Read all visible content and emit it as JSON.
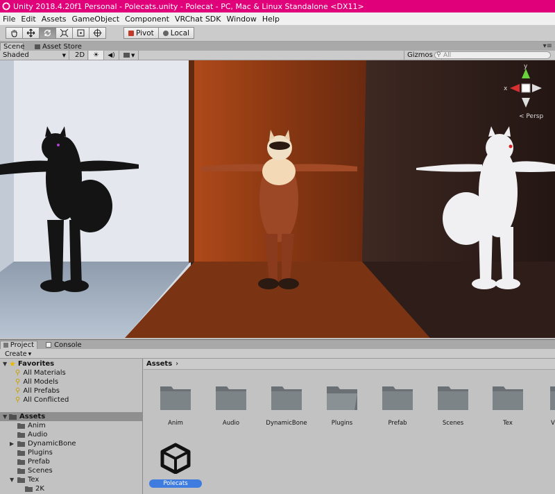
{
  "window": {
    "title": "Unity 2018.4.20f1 Personal - Polecats.unity - Polecat - PC, Mac & Linux Standalone <DX11>"
  },
  "menu": [
    "File",
    "Edit",
    "Assets",
    "GameObject",
    "Component",
    "VRChat SDK",
    "Window",
    "Help"
  ],
  "toolbar": {
    "pivot_label": "Pivot",
    "local_label": "Local"
  },
  "scene_tabs": {
    "scene": "Scene",
    "asset_store": "Asset Store"
  },
  "scene_toolbar": {
    "shading_mode": "Shaded",
    "mode_2d": "2D",
    "gizmos": "Gizmos",
    "search_placeholder": "All"
  },
  "gizmo": {
    "y_label": "y",
    "x_label": "x",
    "projection": "Persp"
  },
  "bottom_tabs": {
    "project": "Project",
    "console": "Console"
  },
  "project_toolbar": {
    "create": "Create"
  },
  "favorites": {
    "label": "Favorites",
    "items": [
      "All Materials",
      "All Models",
      "All Prefabs",
      "All Conflicted"
    ]
  },
  "tree": {
    "root": "Assets",
    "items": [
      "Anim",
      "Audio",
      "DynamicBone",
      "Plugins",
      "Prefab",
      "Scenes",
      "Tex",
      "2K"
    ]
  },
  "breadcrumb": "Assets",
  "assets": {
    "folders": [
      "Anim",
      "Audio",
      "DynamicBone",
      "Plugins",
      "Prefab",
      "Scenes",
      "Tex",
      "V"
    ],
    "scene_file": "Polecats"
  },
  "colors": {
    "titlebar": "#e0007a",
    "selection": "#3e7ce0",
    "wall_left": "#c8d0da",
    "wall_mid": "#7a3414",
    "wall_right": "#2e1d18"
  }
}
